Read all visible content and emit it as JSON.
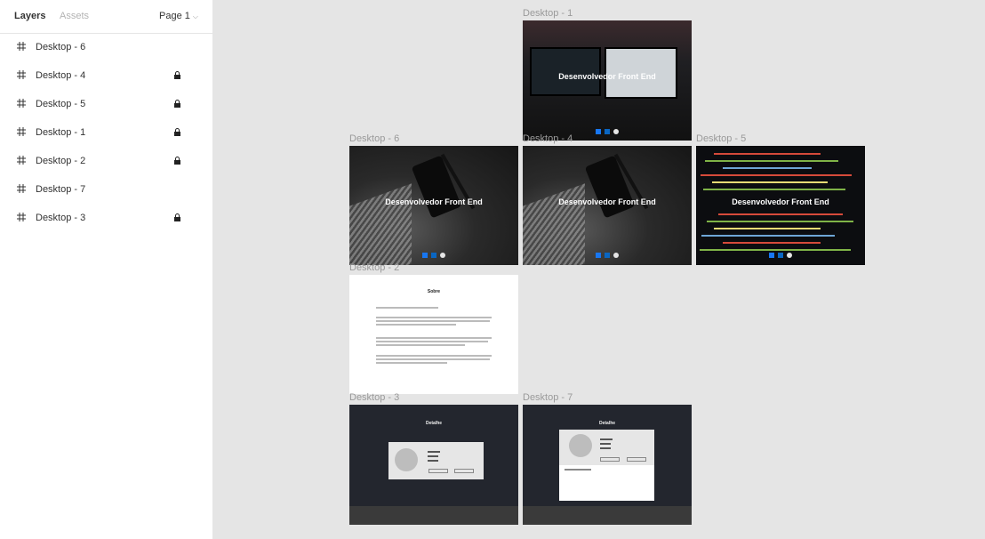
{
  "panel": {
    "tabs": {
      "layers": "Layers",
      "assets": "Assets"
    },
    "page_select": "Page 1",
    "layers": [
      {
        "name": "Desktop - 6",
        "locked": false
      },
      {
        "name": "Desktop - 4",
        "locked": true
      },
      {
        "name": "Desktop - 5",
        "locked": true
      },
      {
        "name": "Desktop - 1",
        "locked": true
      },
      {
        "name": "Desktop - 2",
        "locked": true
      },
      {
        "name": "Desktop - 7",
        "locked": false
      },
      {
        "name": "Desktop - 3",
        "locked": true
      }
    ]
  },
  "canvas": {
    "frames": {
      "d1": {
        "label": "Desktop - 1",
        "title": "Desenvolvedor Front End"
      },
      "d6": {
        "label": "Desktop - 6",
        "title": "Desenvolvedor Front End"
      },
      "d4": {
        "label": "Desktop - 4",
        "title": "Desenvolvedor Front End"
      },
      "d5": {
        "label": "Desktop - 5",
        "title": "Desenvolvedor Front End"
      },
      "d2": {
        "label": "Desktop - 2",
        "heading": "Sobre"
      },
      "d3": {
        "label": "Desktop - 3",
        "heading": "Detalhe"
      },
      "d7": {
        "label": "Desktop - 7",
        "heading": "Detalhe"
      }
    }
  },
  "colors": {
    "panel_bg": "#ffffff",
    "canvas_bg": "#e5e5e5",
    "label": "#9a9a9a",
    "dark_frame": "#23262e",
    "facebook": "#1877f2",
    "linkedin": "#0a66c2"
  },
  "icons": [
    "frame-hash-icon",
    "lock-icon",
    "chevron-down-icon",
    "facebook-icon",
    "linkedin-icon",
    "github-icon"
  ]
}
